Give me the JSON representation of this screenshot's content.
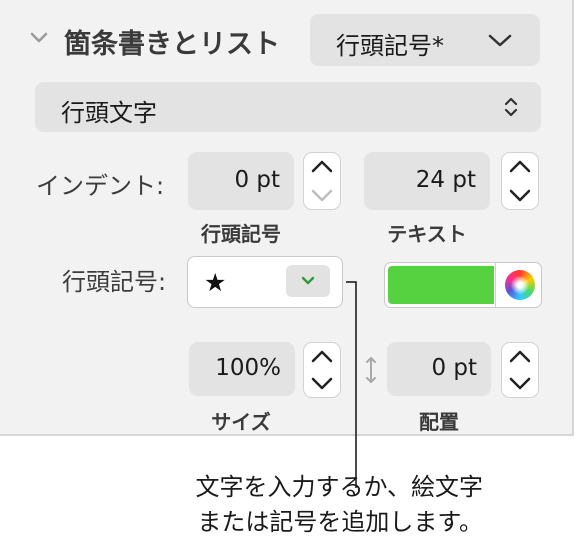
{
  "section": {
    "title": "箇条書きとリスト",
    "style_popup_value": "行頭記号*"
  },
  "bullet_type_popup": {
    "value": "行頭文字"
  },
  "indent": {
    "label": "インデント:",
    "bullet_value": "0 pt",
    "bullet_caption": "行頭記号",
    "text_value": "24 pt",
    "text_caption": "テキスト"
  },
  "bullet": {
    "label": "行頭記号:",
    "symbol": "★",
    "color": "#56d13f"
  },
  "size": {
    "value": "100%",
    "caption": "サイズ"
  },
  "align": {
    "value": "0 pt",
    "caption": "配置"
  },
  "callout": {
    "line1": "文字を入力するか、絵文字",
    "line2": "または記号を追加します。"
  }
}
